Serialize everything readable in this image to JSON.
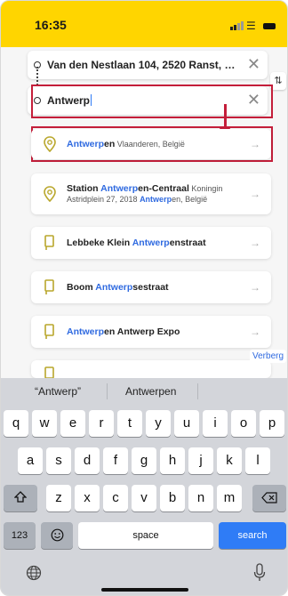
{
  "status": {
    "time": "16:35"
  },
  "route": {
    "origin": "Van den Nestlaan 104, 2520 Ranst, Bel...",
    "destination": "Antwerp",
    "clear_icon": "close-icon"
  },
  "results": [
    {
      "icon": "pin-icon",
      "highlight": "Antwerp",
      "rest": "en",
      "detail": " Vlaanderen, België"
    },
    {
      "icon": "pin-icon",
      "prefix": "Station ",
      "highlight": "Antwerp",
      "rest": "en-Centraal",
      "detail": " Koningin Astridplein 27, 2018 ",
      "highlight2": "Antwerp",
      "rest2": "en, België"
    },
    {
      "icon": "stop-icon",
      "prefix": "Lebbeke Klein ",
      "highlight": "Antwerp",
      "rest": "enstraat"
    },
    {
      "icon": "stop-icon",
      "prefix": "Boom ",
      "highlight": "Antwerp",
      "rest": "sestraat"
    },
    {
      "icon": "stop-icon",
      "highlight": "Antwerp",
      "rest": "en Antwerp Expo"
    }
  ],
  "hide_label": "Verberg",
  "keyboard": {
    "suggestions": [
      "“Antwerp”",
      "Antwerpen",
      ""
    ],
    "row1": [
      "q",
      "w",
      "e",
      "r",
      "t",
      "y",
      "u",
      "i",
      "o",
      "p"
    ],
    "row2": [
      "a",
      "s",
      "d",
      "f",
      "g",
      "h",
      "j",
      "k",
      "l"
    ],
    "row3": [
      "z",
      "x",
      "c",
      "v",
      "b",
      "n",
      "m"
    ],
    "num_label": "123",
    "space_label": "space",
    "search_label": "search"
  }
}
